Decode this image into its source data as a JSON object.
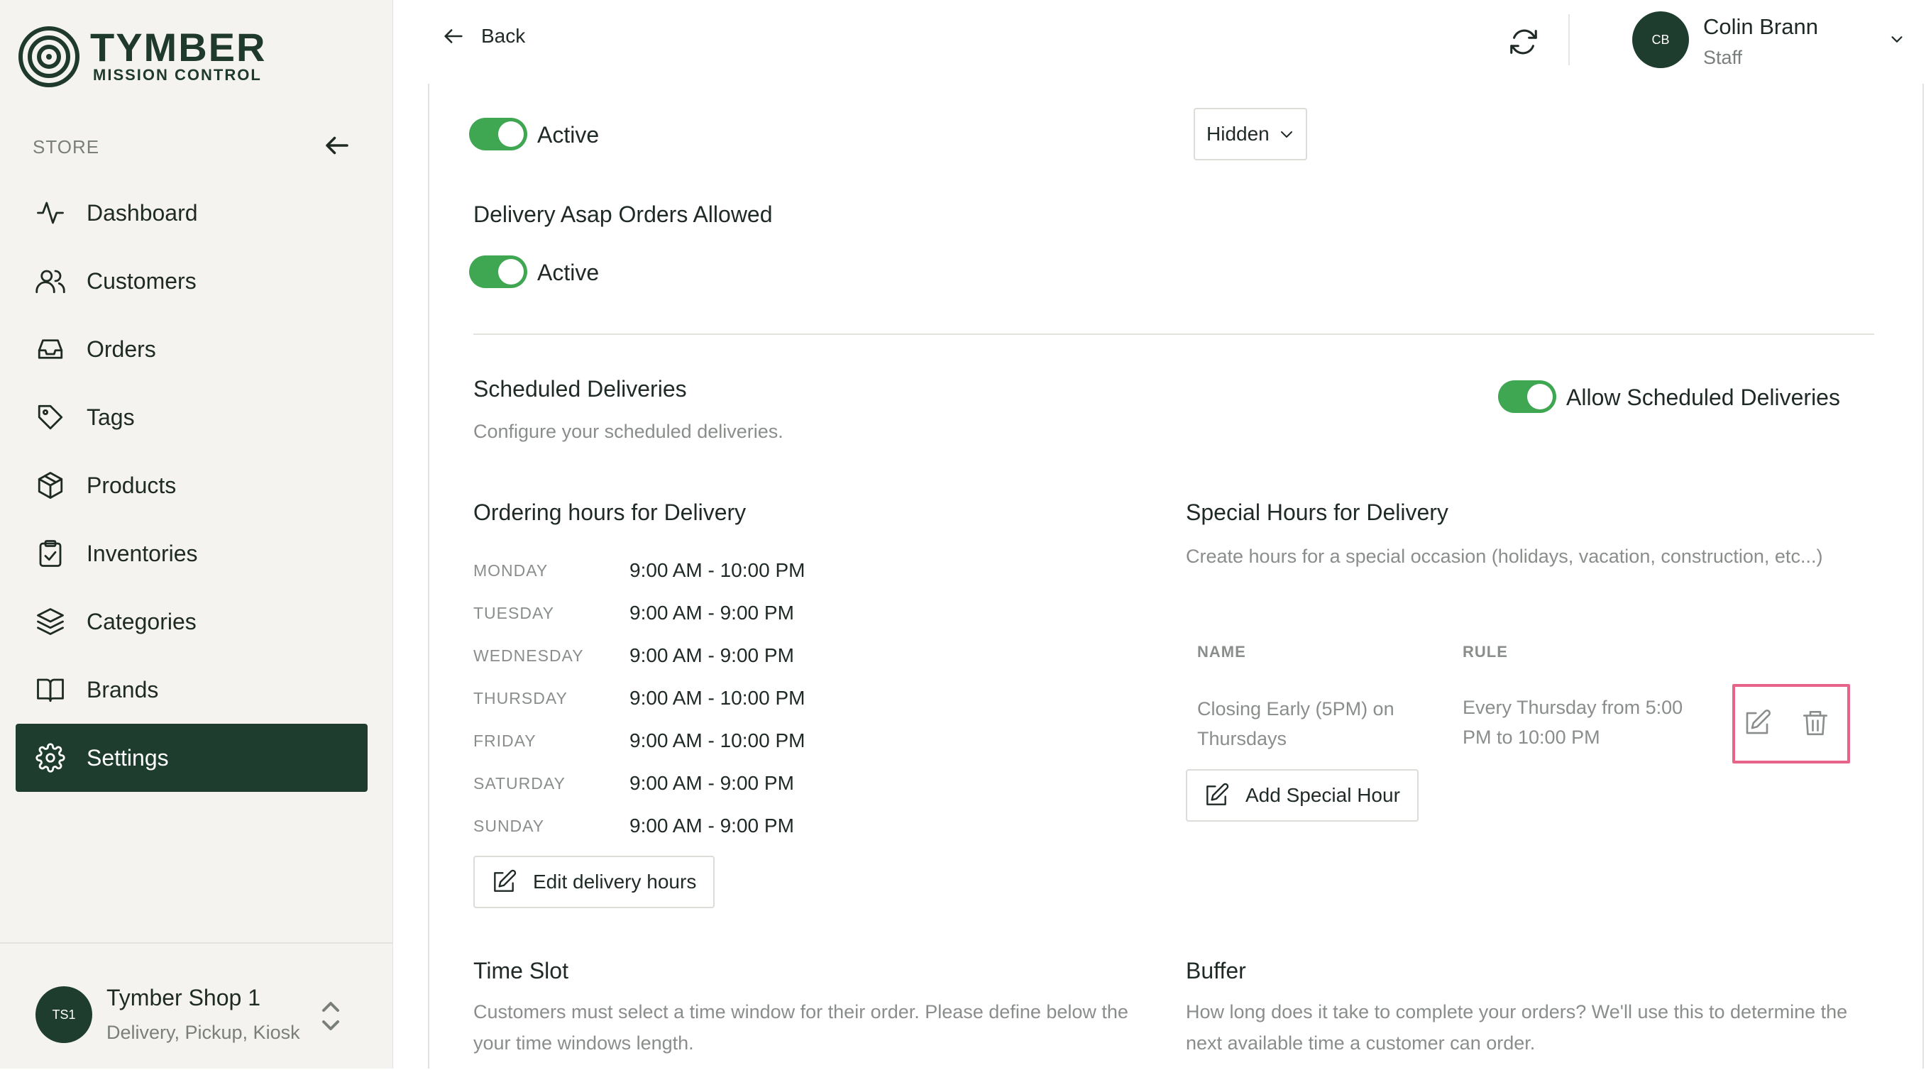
{
  "brand": {
    "name": "TYMBER",
    "subtitle": "MISSION CONTROL"
  },
  "sidebar": {
    "section_label": "STORE",
    "items": [
      {
        "label": "Dashboard",
        "icon": "activity-icon",
        "active": false
      },
      {
        "label": "Customers",
        "icon": "users-icon",
        "active": false
      },
      {
        "label": "Orders",
        "icon": "inbox-icon",
        "active": false
      },
      {
        "label": "Tags",
        "icon": "tag-icon",
        "active": false
      },
      {
        "label": "Products",
        "icon": "box-icon",
        "active": false
      },
      {
        "label": "Inventories",
        "icon": "clipboard-check-icon",
        "active": false
      },
      {
        "label": "Categories",
        "icon": "layers-icon",
        "active": false
      },
      {
        "label": "Brands",
        "icon": "book-open-icon",
        "active": false
      },
      {
        "label": "Settings",
        "icon": "gear-icon",
        "active": true
      }
    ],
    "shop": {
      "initials": "TS1",
      "name": "Tymber Shop 1",
      "channels": "Delivery, Pickup, Kiosk"
    }
  },
  "topbar": {
    "back_label": "Back",
    "user": {
      "initials": "CB",
      "name": "Colin Brann",
      "role": "Staff"
    }
  },
  "colors": {
    "brand_dark": "#1e3d2f",
    "toggle_on": "#3fa652",
    "highlight": "#e8638a"
  },
  "settings": {
    "top_left_toggle": {
      "label": "Active",
      "on": true
    },
    "top_right_select": {
      "value": "Hidden"
    },
    "asap": {
      "title": "Delivery Asap Orders Allowed",
      "toggle_label": "Active",
      "on": true
    },
    "scheduled": {
      "title": "Scheduled Deliveries",
      "description": "Configure your scheduled deliveries.",
      "toggle_label": "Allow Scheduled Deliveries",
      "on": true
    },
    "ordering_hours": {
      "title": "Ordering hours for Delivery",
      "rows": [
        {
          "day": "MONDAY",
          "hours": "9:00 AM - 10:00 PM"
        },
        {
          "day": "TUESDAY",
          "hours": "9:00 AM - 9:00 PM"
        },
        {
          "day": "WEDNESDAY",
          "hours": "9:00 AM - 9:00 PM"
        },
        {
          "day": "THURSDAY",
          "hours": "9:00 AM - 10:00 PM"
        },
        {
          "day": "FRIDAY",
          "hours": "9:00 AM - 10:00 PM"
        },
        {
          "day": "SATURDAY",
          "hours": "9:00 AM - 9:00 PM"
        },
        {
          "day": "SUNDAY",
          "hours": "9:00 AM - 9:00 PM"
        }
      ],
      "edit_button": "Edit delivery hours"
    },
    "special_hours": {
      "title": "Special Hours for Delivery",
      "description": "Create hours for a special occasion (holidays, vacation, construction, etc...)",
      "columns": {
        "name": "NAME",
        "rule": "RULE"
      },
      "rows": [
        {
          "name": "Closing Early (5PM) on Thursdays",
          "rule": "Every Thursday from 5:00 PM to 10:00 PM"
        }
      ],
      "add_button": "Add Special Hour"
    },
    "time_slot": {
      "title": "Time Slot",
      "description": "Customers must select a time window for their order. Please define below the your time windows length."
    },
    "buffer": {
      "title": "Buffer",
      "description": "How long does it take to complete your orders? We'll use this to determine the next available time a customer can order."
    }
  }
}
